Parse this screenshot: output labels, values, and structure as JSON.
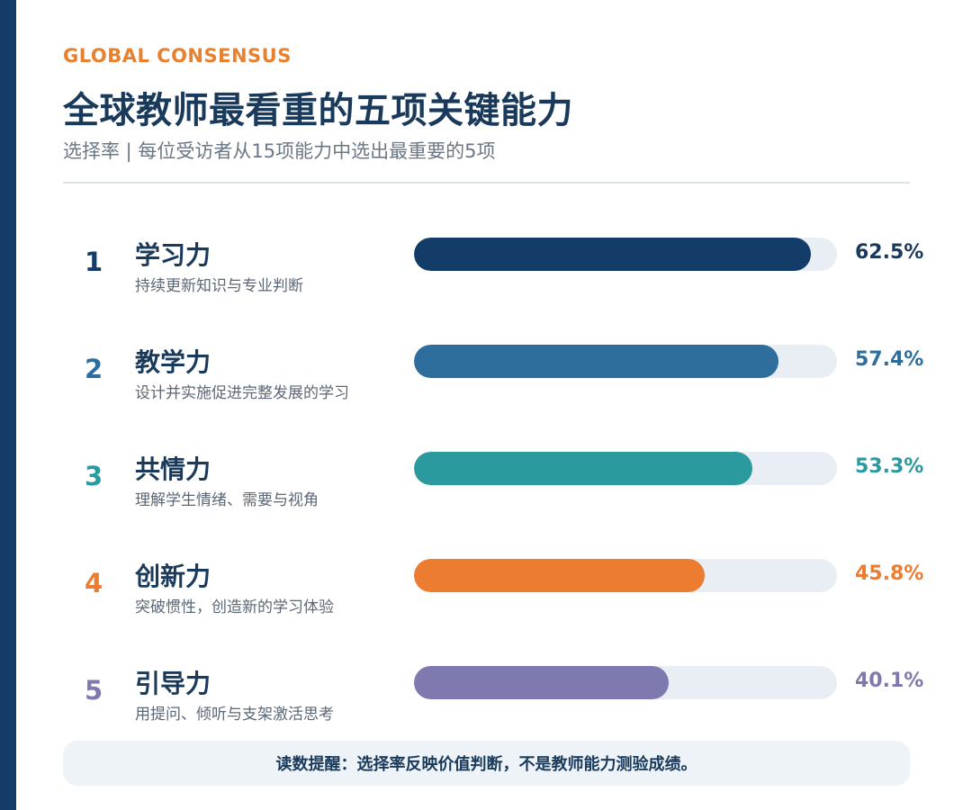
{
  "header": {
    "eyebrow": "GLOBAL CONSENSUS",
    "title": "全球教师最看重的五项关键能力",
    "subtitle": "选择率 | 每位受访者从15项能力中选出最重要的5项"
  },
  "note": "读数提醒：选择率反映价值判断，不是教师能力测验成绩。",
  "colors": {
    "rail": "#143c68",
    "eyebrow": "#e8812f",
    "track": "#e9eef4"
  },
  "chart_data": {
    "type": "bar",
    "orientation": "horizontal",
    "xlim": [
      0,
      100
    ],
    "unit": "%",
    "items": [
      {
        "rank": "1",
        "name": "学习力",
        "desc": "持续更新知识与专业判断",
        "value": 62.5,
        "label": "62.5%",
        "color": "#143c68",
        "rank_color": "#143c68",
        "value_color": "#1a3a5c"
      },
      {
        "rank": "2",
        "name": "教学力",
        "desc": "设计并实施促进完整发展的学习",
        "value": 57.4,
        "label": "57.4%",
        "color": "#2e6e9e",
        "rank_color": "#2e6e9e",
        "value_color": "#2e6e9e"
      },
      {
        "rank": "3",
        "name": "共情力",
        "desc": "理解学生情绪、需要与视角",
        "value": 53.3,
        "label": "53.3%",
        "color": "#2a9a9e",
        "rank_color": "#2a9a9e",
        "value_color": "#2a9a9e"
      },
      {
        "rank": "4",
        "name": "创新力",
        "desc": "突破惯性，创造新的学习体验",
        "value": 45.8,
        "label": "45.8%",
        "color": "#ec7c30",
        "rank_color": "#ec7c30",
        "value_color": "#ec7c30"
      },
      {
        "rank": "5",
        "name": "引导力",
        "desc": "用提问、倾听与支架激活思考",
        "value": 40.1,
        "label": "40.1%",
        "color": "#7e7ab0",
        "rank_color": "#7e7ab0",
        "value_color": "#7e7ab0"
      }
    ]
  }
}
